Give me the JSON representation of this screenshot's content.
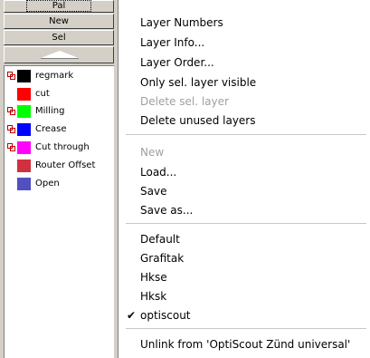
{
  "panel": {
    "pal_label": "Pal",
    "new_label": "New",
    "sel_label": "Sel",
    "layers": [
      {
        "name": "regmark",
        "color": "#000000",
        "locked": true
      },
      {
        "name": "cut",
        "color": "#ff0000",
        "locked": false
      },
      {
        "name": "Milling",
        "color": "#00ff00",
        "locked": true
      },
      {
        "name": "Crease",
        "color": "#0000ff",
        "locked": true
      },
      {
        "name": "Cut through",
        "color": "#ff00ff",
        "locked": true
      },
      {
        "name": "Router Offset",
        "color": "#d03040",
        "locked": false
      },
      {
        "name": "Open",
        "color": "#5050c0",
        "locked": false
      }
    ]
  },
  "menu": {
    "items": [
      {
        "label": "Layer Numbers",
        "disabled": false
      },
      {
        "label": "Layer Info...",
        "disabled": false
      },
      {
        "label": "Layer Order...",
        "disabled": false
      },
      {
        "label": "Only sel. layer visible",
        "disabled": false
      },
      {
        "label": "Delete sel. layer",
        "disabled": true
      },
      {
        "label": "Delete unused layers",
        "disabled": false
      },
      {
        "label": "New",
        "disabled": true
      },
      {
        "label": "Load...",
        "disabled": false
      },
      {
        "label": "Save",
        "disabled": false
      },
      {
        "label": "Save as...",
        "disabled": false
      },
      {
        "label": "Default",
        "disabled": false
      },
      {
        "label": "Grafitak",
        "disabled": false
      },
      {
        "label": "Hkse",
        "disabled": false
      },
      {
        "label": "Hksk",
        "disabled": false
      },
      {
        "label": "optiscout",
        "disabled": false,
        "checked": true
      },
      {
        "label": "Unlink from 'OptiScout Zünd universal'",
        "disabled": false
      }
    ]
  },
  "icons": {
    "lock": "layer-lock-icon",
    "scroll_up": "triangle-up-icon",
    "check": "checkmark-icon"
  }
}
